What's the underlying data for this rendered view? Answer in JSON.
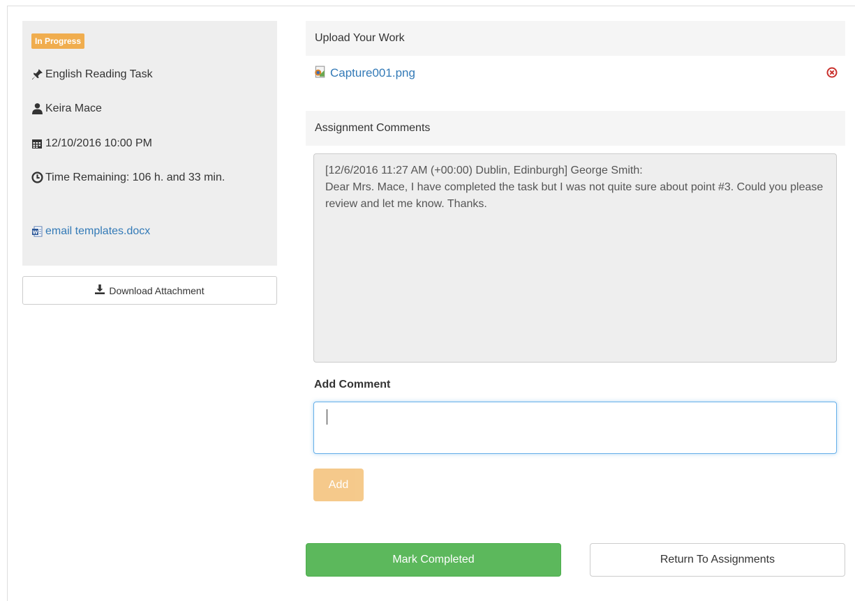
{
  "task": {
    "status": "In Progress",
    "title": "English Reading Task",
    "teacher": "Keira Mace",
    "due": "12/10/2016 10:00 PM",
    "time_remaining": "Time Remaining: 106 h. and 33 min.",
    "attachment": "email templates.docx",
    "download_label": "Download Attachment"
  },
  "upload": {
    "heading": "Upload Your Work",
    "file_name": "Capture001.png"
  },
  "comments": {
    "heading": "Assignment Comments",
    "header_line": "[12/6/2016 11:27 AM (+00:00) Dublin, Edinburgh] George Smith:",
    "body": "Dear Mrs. Mace, I have completed the task but I was not quite sure about point #3. Could you please review and let me know. Thanks.",
    "add_label": "Add Comment",
    "input_value": "",
    "add_button": "Add"
  },
  "actions": {
    "complete": "Mark Completed",
    "return": "Return To Assignments"
  },
  "colors": {
    "status_badge": "#f0ad4e",
    "link": "#337ab7",
    "complete": "#5cb85c",
    "remove_icon": "#c9302c"
  },
  "icons": [
    "pushpin-icon",
    "user-icon",
    "calendar-icon",
    "clock-icon",
    "word-doc-icon",
    "download-icon",
    "image-file-icon",
    "remove-circle-icon"
  ]
}
